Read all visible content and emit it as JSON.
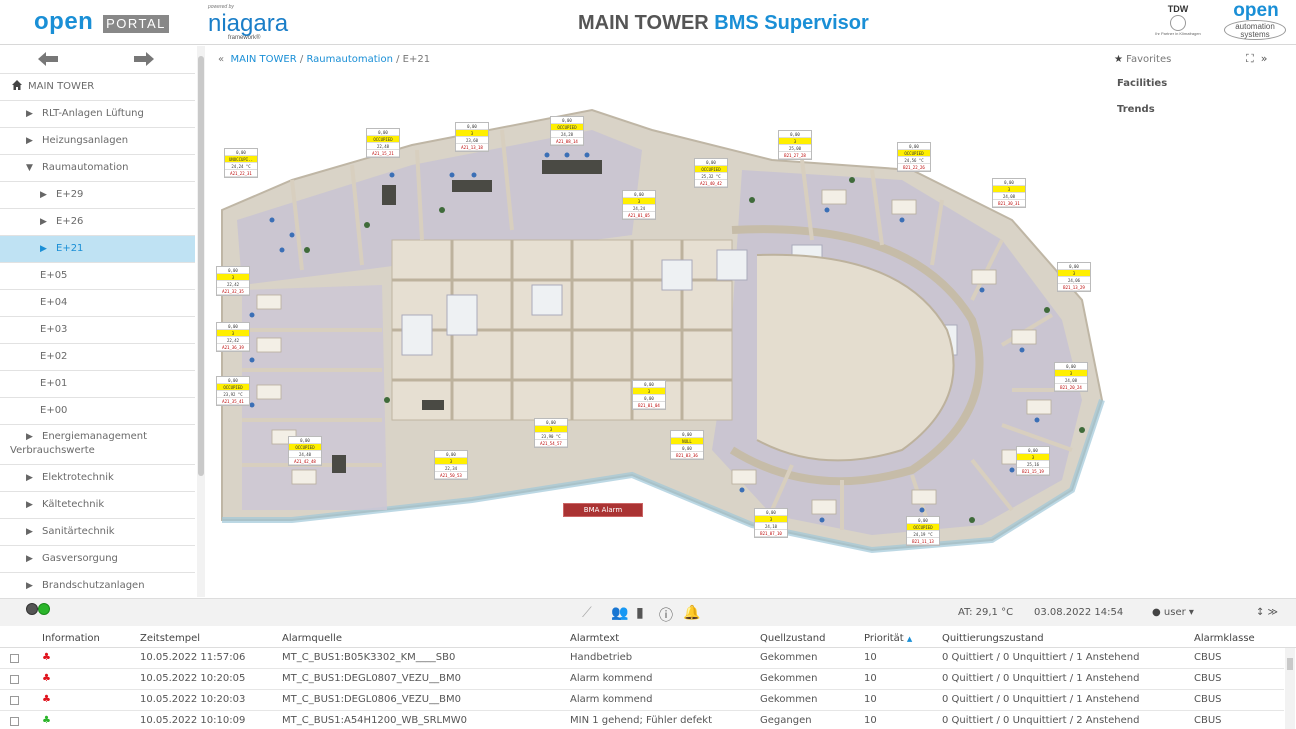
{
  "header": {
    "brand_open": "open",
    "brand_portal": "PORTAL",
    "powered_by": "powered by",
    "niagara": "niagara",
    "niagara_framework": "framework®",
    "title_main": "MAIN TOWER",
    "title_accent": "BMS Supervisor",
    "tdw": "TDW",
    "tdw_sub": "Ihr Partner in Klimafragen",
    "oas_open": "open",
    "oas_line1": "automation",
    "oas_line2": "systems"
  },
  "sidebar": {
    "items": [
      {
        "label": "MAIN TOWER",
        "arrow": "",
        "icon": "home-icon"
      },
      {
        "label": "RLT-Anlagen Lüftung",
        "arrow": "▶"
      },
      {
        "label": "Heizungsanlagen",
        "arrow": "▶"
      },
      {
        "label": "Raumautomation",
        "arrow": "▼"
      },
      {
        "label": "E+29",
        "arrow": "▶"
      },
      {
        "label": "E+26",
        "arrow": "▶"
      },
      {
        "label": "E+21",
        "arrow": "▶"
      },
      {
        "label": "E+05",
        "arrow": ""
      },
      {
        "label": "E+04",
        "arrow": ""
      },
      {
        "label": "E+03",
        "arrow": ""
      },
      {
        "label": "E+02",
        "arrow": ""
      },
      {
        "label": "E+01",
        "arrow": ""
      },
      {
        "label": "E+00",
        "arrow": ""
      },
      {
        "label_line1": "Energiemanagement",
        "label_line2": "Verbrauchswerte",
        "arrow": "▶"
      },
      {
        "label": "Elektrotechnik",
        "arrow": "▶"
      },
      {
        "label": "Kältetechnik",
        "arrow": "▶"
      },
      {
        "label": "Sanitärtechnik",
        "arrow": "▶"
      },
      {
        "label": "Gasversorgung",
        "arrow": "▶"
      },
      {
        "label": "Brandschutzanlagen",
        "arrow": "▶"
      }
    ]
  },
  "breadcrumb": {
    "prefix": "«",
    "items": [
      "MAIN TOWER",
      "Raumautomation",
      "E+21"
    ],
    "sep": "/"
  },
  "right_panel": {
    "favorites": "Favorites",
    "links": [
      "Facilities",
      "Trends"
    ]
  },
  "floorplan": {
    "bma_alarm": "BMA Alarm",
    "datapoints": [
      {
        "vals": [
          "0,00",
          "UNOCCUPI..",
          "24,24 °C"
        ],
        "id": "A21_22_31",
        "yellow": [
          1
        ]
      },
      {
        "vals": [
          "0,00",
          "OCCUPIED",
          "22,48"
        ],
        "id": "A21_15_21",
        "yellow": [
          1
        ]
      },
      {
        "vals": [
          "0,00",
          "3",
          "23,60"
        ],
        "id": "A21_13_18",
        "yellow": [
          1
        ]
      },
      {
        "vals": [
          "0,00",
          "OCCUPIED",
          "24,28"
        ],
        "id": "A21_08_14",
        "yellow": [
          1
        ]
      },
      {
        "vals": [
          "0,00",
          "OCCUPIED",
          "25,32 °C"
        ],
        "id": "A21_40_42",
        "yellow": [
          1
        ]
      },
      {
        "vals": [
          "0,00",
          "3",
          "24,24"
        ],
        "id": "A21_01_05",
        "yellow": [
          1
        ]
      },
      {
        "vals": [
          "0,00",
          "3",
          "25,00"
        ],
        "id": "B21_27_28",
        "yellow": [
          1
        ]
      },
      {
        "vals": [
          "0,00",
          "OCCUPIED",
          "24,56 °C"
        ],
        "id": "B21_22_26",
        "yellow": [
          1
        ]
      },
      {
        "vals": [
          "0,00",
          "3",
          "24,08"
        ],
        "id": "B21_30_31",
        "yellow": [
          1
        ]
      },
      {
        "vals": [
          "0,00",
          "3",
          "22,42"
        ],
        "id": "A21_32_35",
        "yellow": [
          1
        ]
      },
      {
        "vals": [
          "0,00",
          "3",
          "22,42"
        ],
        "id": "A21_36_39",
        "yellow": [
          1
        ]
      },
      {
        "vals": [
          "0,00",
          "OCCUPIED",
          "23,92 °C"
        ],
        "id": "A21_35_41",
        "yellow": [
          1
        ]
      },
      {
        "vals": [
          "0,00",
          "3",
          "24,06"
        ],
        "id": "B21_13_29",
        "yellow": [
          1
        ]
      },
      {
        "vals": [
          "0,00",
          "3",
          "24,08"
        ],
        "id": "B21_20_24",
        "yellow": [
          1
        ]
      },
      {
        "vals": [
          "0,00",
          "OCCUPIED",
          "24,40"
        ],
        "id": "A21_42_48",
        "yellow": [
          1
        ]
      },
      {
        "vals": [
          "0,00",
          "3",
          "22,34"
        ],
        "id": "A21_50_53",
        "yellow": [
          1
        ]
      },
      {
        "vals": [
          "0,00",
          "3",
          "23,90 °C"
        ],
        "id": "A21_54_57",
        "yellow": [
          1
        ]
      },
      {
        "vals": [
          "0,00",
          "3",
          "0,00"
        ],
        "id": "B21_01_04",
        "yellow": [
          1
        ]
      },
      {
        "vals": [
          "0,00",
          "NULL",
          "0,00"
        ],
        "id": "B21_03_36",
        "yellow": [
          1
        ]
      },
      {
        "vals": [
          "0,00",
          "3",
          "25,16"
        ],
        "id": "B21_15_19",
        "yellow": [
          1
        ]
      },
      {
        "vals": [
          "0,00",
          "3",
          "24,10"
        ],
        "id": "B21_07_10",
        "yellow": [
          1
        ]
      },
      {
        "vals": [
          "0,00",
          "OCCUPIED",
          "24,19 °C"
        ],
        "id": "B21_11_13",
        "yellow": [
          1
        ]
      }
    ]
  },
  "toolbar": {
    "temperature": "AT: 29,1 °C",
    "datetime": "03.08.2022 14:54",
    "user": "user ▾"
  },
  "alarm_table": {
    "columns": [
      "Information",
      "Zeitstempel",
      "Alarmquelle",
      "Alarmtext",
      "Quellzustand",
      "Priorität",
      "Quittierungszustand",
      "Alarmklasse"
    ],
    "rows": [
      {
        "icon": "bell-red",
        "ts": "10.05.2022 11:57:06",
        "src": "MT_C_BUS1:B05K3302_KM____SB0",
        "text": "Handbetrieb",
        "state": "Gekommen",
        "prio": "10",
        "ack": "0 Quittiert / 0 Unquittiert / 1 Anstehend",
        "cls": "CBUS"
      },
      {
        "icon": "bell-red",
        "ts": "10.05.2022 10:20:05",
        "src": "MT_C_BUS1:DEGL0807_VEZU__BM0",
        "text": "Alarm kommend",
        "state": "Gekommen",
        "prio": "10",
        "ack": "0 Quittiert / 0 Unquittiert / 1 Anstehend",
        "cls": "CBUS"
      },
      {
        "icon": "bell-red",
        "ts": "10.05.2022 10:20:03",
        "src": "MT_C_BUS1:DEGL0806_VEZU__BM0",
        "text": "Alarm kommend",
        "state": "Gekommen",
        "prio": "10",
        "ack": "0 Quittiert / 0 Unquittiert / 1 Anstehend",
        "cls": "CBUS"
      },
      {
        "icon": "bell-green",
        "ts": "10.05.2022 10:10:09",
        "src": "MT_C_BUS1:A54H1200_WB_SRLMW0",
        "text": "MIN 1 gehend; Fühler defekt",
        "state": "Gegangen",
        "prio": "10",
        "ack": "0 Quittiert / 0 Unquittiert / 2 Anstehend",
        "cls": "CBUS"
      }
    ]
  },
  "colors": {
    "accent": "#1a8fd6",
    "selected_bg": "#bfe2f3",
    "alarm_red": "#e0141e",
    "ok_green": "#2bb52b",
    "occupied_yellow": "#ffef00"
  }
}
